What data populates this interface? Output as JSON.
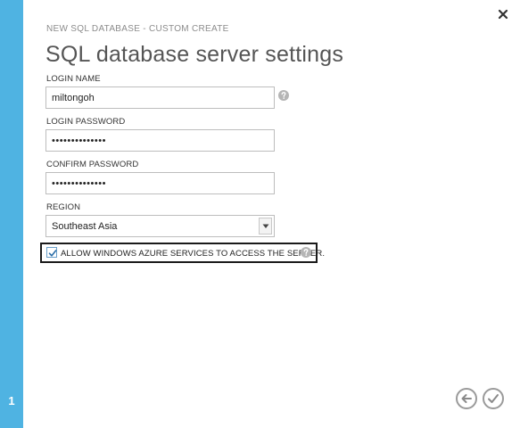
{
  "wizard": {
    "breadcrumb": "NEW SQL DATABASE - CUSTOM CREATE",
    "title": "SQL database server settings",
    "step_number": "1"
  },
  "form": {
    "login_name": {
      "label": "LOGIN NAME",
      "value": "miltongoh"
    },
    "login_password": {
      "label": "LOGIN PASSWORD",
      "value": "••••••••••••••"
    },
    "confirm_password": {
      "label": "CONFIRM PASSWORD",
      "value": "••••••••••••••"
    },
    "region": {
      "label": "REGION",
      "selected": "Southeast Asia"
    },
    "allow_azure": {
      "label": "ALLOW WINDOWS AZURE SERVICES TO ACCESS THE SERVER.",
      "checked": true
    }
  },
  "icons": {
    "close": "close-icon",
    "help": "help-icon",
    "back": "arrow-left-icon",
    "complete": "checkmark-icon",
    "dropdown": "chevron-down-icon"
  },
  "colors": {
    "rail": "#4fb3e2",
    "checkbox_border": "#6a9fc9",
    "highlight_frame": "#1a1a1a"
  }
}
